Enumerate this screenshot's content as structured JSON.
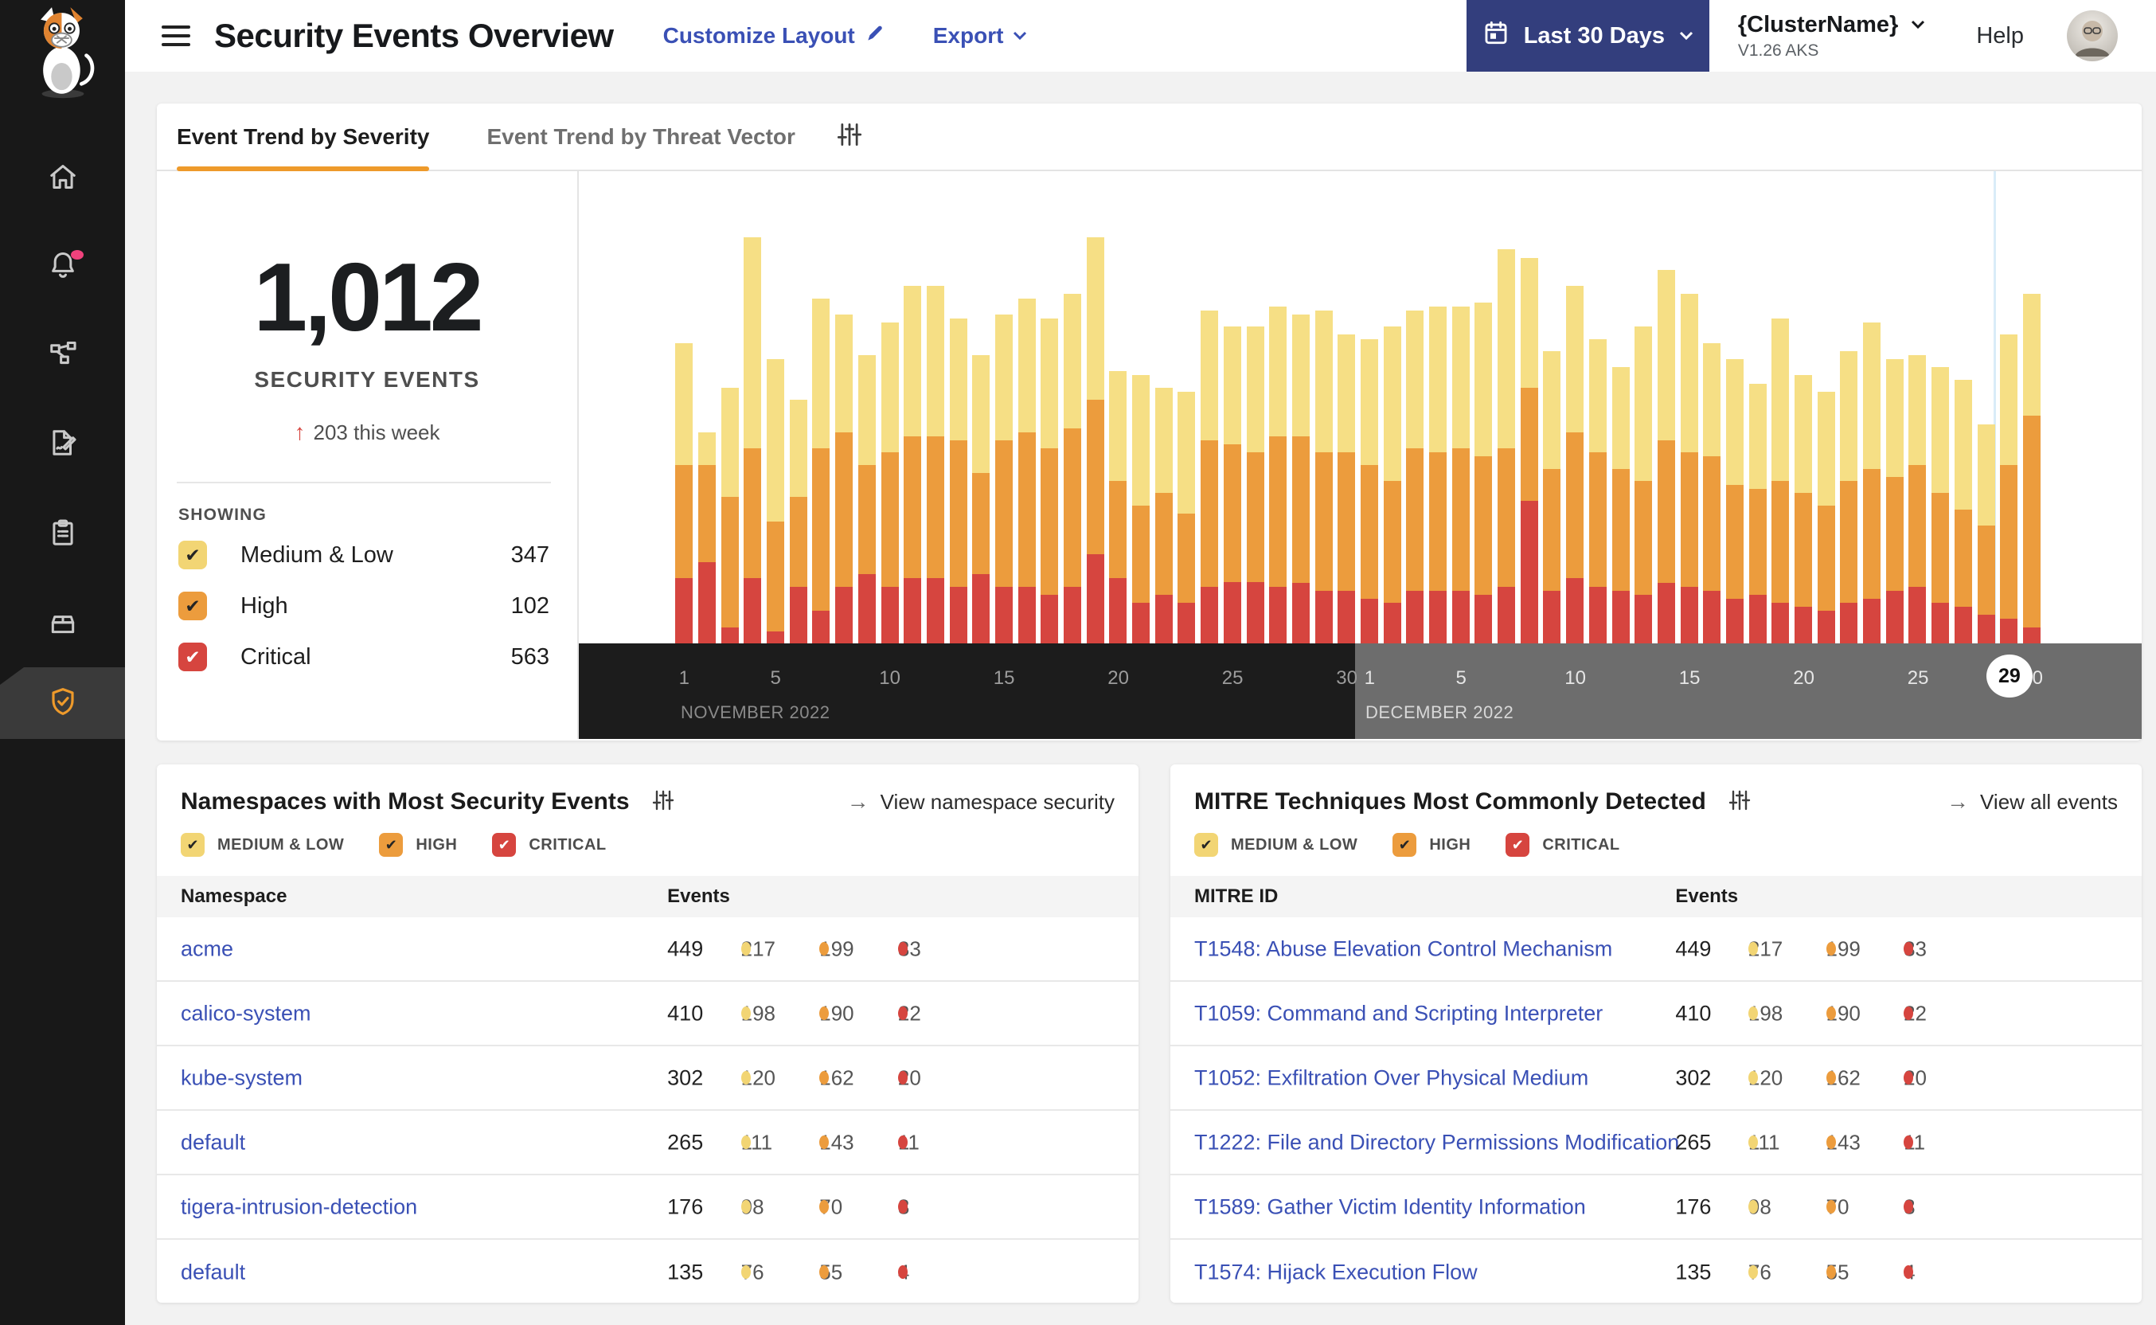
{
  "colors": {
    "medium": "#F2D574",
    "high": "#EC9C3D",
    "critical": "#D6453F",
    "accent_orange": "#EE9A2B",
    "link_blue": "#3A50B5",
    "button_indigo": "#333E7D",
    "nov_band": "#1C1C1C",
    "dec_band": "#6D6D6D",
    "highlight_line": "#D9ECF8"
  },
  "header": {
    "title": "Security Events Overview",
    "customize_layout": "Customize Layout",
    "export": "Export",
    "date_range": "Last 30 Days",
    "cluster_name": "{ClusterName}",
    "cluster_version": "V1.26 AKS",
    "help": "Help"
  },
  "sidebar": {
    "items": [
      "home",
      "alerts",
      "service-graph",
      "policies",
      "reports",
      "catalog",
      "threat-defense"
    ],
    "active_item": "threat-defense",
    "alerts_has_badge": true
  },
  "trend_card": {
    "tabs": [
      {
        "label": "Event Trend by Severity",
        "active": true
      },
      {
        "label": "Event Trend by Threat Vector",
        "active": false
      }
    ],
    "summary": {
      "total": "1,012",
      "label": "SECURITY EVENTS",
      "delta": "203 this week"
    },
    "showing_label": "SHOWING",
    "showing": [
      {
        "label": "Medium & Low",
        "count": 347,
        "key": "medium"
      },
      {
        "label": "High",
        "count": 102,
        "key": "high"
      },
      {
        "label": "Critical",
        "count": 563,
        "key": "critical"
      }
    ]
  },
  "chart_data": {
    "type": "bar",
    "stacked": true,
    "x_months": [
      {
        "label": "NOVEMBER 2022",
        "days": 30,
        "ticks": [
          1,
          5,
          10,
          15,
          20,
          25,
          30
        ],
        "start_index": 0
      },
      {
        "label": "DECEMBER 2022",
        "days": 30,
        "ticks": [
          1,
          5,
          10,
          15,
          20,
          25,
          30
        ],
        "start_index": 30,
        "highlight_day": 29
      }
    ],
    "series": [
      {
        "name": "Medium & Low",
        "color": "#F6DF85",
        "values": [
          30,
          8,
          27,
          52,
          40,
          24,
          37,
          29,
          27,
          32,
          37,
          37,
          30,
          29,
          31,
          33,
          32,
          33,
          40,
          27,
          32,
          26,
          30,
          32,
          29,
          31,
          32,
          30,
          35,
          29,
          31,
          38,
          34,
          36,
          35,
          38,
          49,
          32,
          29,
          36,
          28,
          25,
          38,
          42,
          39,
          28,
          31,
          26,
          40,
          29,
          28,
          32,
          36,
          29,
          27,
          31,
          32,
          25,
          32,
          30
        ]
      },
      {
        "name": "High",
        "color": "#EC9C3D",
        "values": [
          28,
          24,
          32,
          32,
          27,
          22,
          40,
          38,
          27,
          33,
          35,
          35,
          36,
          25,
          36,
          38,
          36,
          39,
          38,
          24,
          24,
          25,
          22,
          36,
          34,
          32,
          37,
          36,
          34,
          34,
          33,
          30,
          35,
          34,
          35,
          34,
          34,
          28,
          30,
          36,
          33,
          30,
          28,
          35,
          33,
          33,
          28,
          26,
          30,
          28,
          26,
          30,
          32,
          28,
          30,
          27,
          24,
          22,
          38,
          52
        ]
      },
      {
        "name": "Critical",
        "color": "#D6453F",
        "values": [
          16,
          20,
          4,
          16,
          3,
          14,
          8,
          14,
          17,
          14,
          16,
          16,
          14,
          17,
          14,
          14,
          12,
          14,
          22,
          16,
          10,
          12,
          10,
          14,
          15,
          15,
          14,
          15,
          13,
          13,
          11,
          10,
          13,
          13,
          13,
          12,
          14,
          35,
          13,
          16,
          14,
          13,
          12,
          15,
          14,
          13,
          11,
          12,
          10,
          9,
          8,
          10,
          11,
          13,
          14,
          10,
          9,
          7,
          6,
          4
        ]
      }
    ],
    "ylim": [
      0,
      100
    ],
    "grid": false,
    "legend_position": "left-panel"
  },
  "namespaces_card": {
    "title": "Namespaces with Most Security Events",
    "link": "View namespace security",
    "filters": [
      {
        "label": "MEDIUM & LOW",
        "key": "medium"
      },
      {
        "label": "HIGH",
        "key": "high"
      },
      {
        "label": "CRITICAL",
        "key": "critical"
      }
    ],
    "columns": [
      "Namespace",
      "Events"
    ],
    "rows": [
      {
        "name": "acme",
        "total": 449,
        "medium": 217,
        "high": 199,
        "critical": 33
      },
      {
        "name": "calico-system",
        "total": 410,
        "medium": 198,
        "high": 190,
        "critical": 22
      },
      {
        "name": "kube-system",
        "total": 302,
        "medium": 120,
        "high": 162,
        "critical": 20
      },
      {
        "name": "default",
        "total": 265,
        "medium": 111,
        "high": 143,
        "critical": 11
      },
      {
        "name": "tigera-intrusion-detection",
        "total": 176,
        "medium": 98,
        "high": 70,
        "critical": 8
      },
      {
        "name": "default",
        "total": 135,
        "medium": 76,
        "high": 55,
        "critical": 4
      }
    ]
  },
  "mitre_card": {
    "title": "MITRE Techniques Most Commonly Detected",
    "link": "View all events",
    "filters": [
      {
        "label": "MEDIUM & LOW",
        "key": "medium"
      },
      {
        "label": "HIGH",
        "key": "high"
      },
      {
        "label": "CRITICAL",
        "key": "critical"
      }
    ],
    "columns": [
      "MITRE ID",
      "Events"
    ],
    "rows": [
      {
        "name": "T1548: Abuse Elevation Control Mechanism",
        "total": 449,
        "medium": 217,
        "high": 199,
        "critical": 33
      },
      {
        "name": "T1059: Command and Scripting Interpreter",
        "total": 410,
        "medium": 198,
        "high": 190,
        "critical": 22
      },
      {
        "name": "T1052: Exfiltration Over Physical Medium",
        "total": 302,
        "medium": 120,
        "high": 162,
        "critical": 20
      },
      {
        "name": "T1222: File and Directory Permissions Modification",
        "total": 265,
        "medium": 111,
        "high": 143,
        "critical": 11
      },
      {
        "name": "T1589: Gather Victim Identity Information",
        "total": 176,
        "medium": 98,
        "high": 70,
        "critical": 8
      },
      {
        "name": "T1574: Hijack Execution Flow",
        "total": 135,
        "medium": 76,
        "high": 55,
        "critical": 4
      }
    ]
  }
}
